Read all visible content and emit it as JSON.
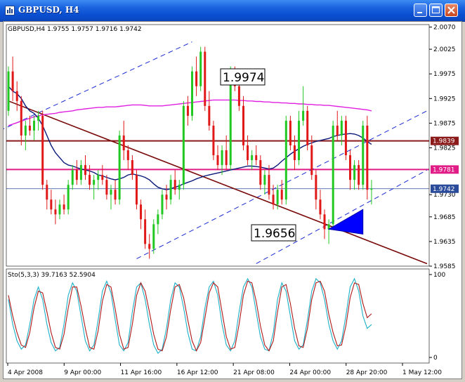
{
  "window": {
    "title": "GBPUSD, H4",
    "title_color": "#ffffff",
    "titlebar_color": "#0a4fd1",
    "close_color": "#c9461f"
  },
  "chart_data": [
    {
      "type": "candlestick",
      "title": "GBPUSD,H4 1.9755 1.9757 1.9716 1.9742",
      "symbol": "GBPUSD",
      "timeframe": "H4",
      "ylim": [
        1.9585,
        2.0075
      ],
      "y_ticks": [
        "2.0070",
        "2.0025",
        "1.9975",
        "1.9925",
        "1.9875",
        "1.9825",
        "1.9730",
        "1.9685",
        "1.9635",
        "1.9585"
      ],
      "x_ticks": [
        "4 Apr 2008",
        "9 Apr 00:00",
        "11 Apr 16:00",
        "16 Apr 12:00",
        "21 Apr 08:00",
        "24 Apr 00:00",
        "28 Apr 20:00",
        "1 May 12:00"
      ],
      "price_labels": [
        {
          "text": "1.9839",
          "value": 1.9839,
          "color": "#8b1a1a"
        },
        {
          "text": "1.9781",
          "value": 1.9781,
          "color": "#e01c86"
        },
        {
          "text": "1.9742",
          "value": 1.9742,
          "color": "#2a4a9a"
        }
      ],
      "annotations": [
        {
          "text": "1.9974",
          "value": 1.9974
        },
        {
          "text": "1.9656",
          "value": 1.9656
        }
      ],
      "colors": {
        "bull": "#22c822",
        "bear": "#e01818",
        "ma_fast": "#0a1a7a",
        "ma_slow": "#e020e0",
        "trend": "#7a0a0a",
        "channel": "#1a2ad0"
      },
      "candles": [
        [
          1.99,
          1.999,
          1.989,
          1.998
        ],
        [
          1.998,
          2.001,
          1.992,
          1.994
        ],
        [
          1.994,
          1.996,
          1.99,
          1.992
        ],
        [
          1.992,
          1.993,
          1.983,
          1.985
        ],
        [
          1.985,
          1.988,
          1.982,
          1.987
        ],
        [
          1.987,
          1.989,
          1.985,
          1.986
        ],
        [
          1.986,
          1.989,
          1.984,
          1.988
        ],
        [
          1.988,
          1.99,
          1.986,
          1.989
        ],
        [
          1.989,
          1.99,
          1.974,
          1.975
        ],
        [
          1.975,
          1.976,
          1.97,
          1.972
        ],
        [
          1.972,
          1.974,
          1.969,
          1.97
        ],
        [
          1.97,
          1.972,
          1.967,
          1.969
        ],
        [
          1.969,
          1.972,
          1.968,
          1.971
        ],
        [
          1.971,
          1.973,
          1.969,
          1.97
        ],
        [
          1.97,
          1.976,
          1.969,
          1.975
        ],
        [
          1.975,
          1.979,
          1.974,
          1.978
        ],
        [
          1.978,
          1.98,
          1.975,
          1.976
        ],
        [
          1.976,
          1.98,
          1.975,
          1.979
        ],
        [
          1.979,
          1.981,
          1.976,
          1.977
        ],
        [
          1.977,
          1.979,
          1.974,
          1.975
        ],
        [
          1.975,
          1.977,
          1.972,
          1.976
        ],
        [
          1.976,
          1.978,
          1.974,
          1.977
        ],
        [
          1.977,
          1.979,
          1.975,
          1.976
        ],
        [
          1.976,
          1.977,
          1.972,
          1.973
        ],
        [
          1.973,
          1.975,
          1.97,
          1.974
        ],
        [
          1.974,
          1.976,
          1.971,
          1.972
        ],
        [
          1.972,
          1.986,
          1.971,
          1.985
        ],
        [
          1.985,
          1.988,
          1.98,
          1.982
        ],
        [
          1.982,
          1.983,
          1.978,
          1.98
        ],
        [
          1.98,
          1.981,
          1.976,
          1.977
        ],
        [
          1.977,
          1.978,
          1.97,
          1.971
        ],
        [
          1.971,
          1.972,
          1.966,
          1.968
        ],
        [
          1.968,
          1.97,
          1.962,
          1.963
        ],
        [
          1.963,
          1.965,
          1.96,
          1.962
        ],
        [
          1.962,
          1.968,
          1.961,
          1.967
        ],
        [
          1.967,
          1.97,
          1.965,
          1.969
        ],
        [
          1.969,
          1.974,
          1.968,
          1.973
        ],
        [
          1.973,
          1.975,
          1.97,
          1.972
        ],
        [
          1.972,
          1.977,
          1.971,
          1.976
        ],
        [
          1.976,
          1.978,
          1.973,
          1.974
        ],
        [
          1.974,
          1.976,
          1.972,
          1.975
        ],
        [
          1.975,
          1.992,
          1.974,
          1.991
        ],
        [
          1.991,
          1.993,
          1.987,
          1.989
        ],
        [
          1.989,
          1.999,
          1.988,
          1.998
        ],
        [
          1.998,
          2.001,
          1.993,
          1.995
        ],
        [
          1.995,
          2.003,
          1.994,
          2.002
        ],
        [
          2.002,
          2.003,
          1.99,
          1.991
        ],
        [
          1.991,
          1.994,
          1.986,
          1.987
        ],
        [
          1.987,
          1.988,
          1.98,
          1.981
        ],
        [
          1.981,
          1.983,
          1.978,
          1.979
        ],
        [
          1.979,
          1.983,
          1.977,
          1.982
        ],
        [
          1.982,
          1.985,
          1.978,
          1.979
        ],
        [
          1.979,
          1.999,
          1.978,
          1.998
        ],
        [
          1.998,
          1.999,
          1.994,
          1.995
        ],
        [
          1.995,
          1.998,
          1.99,
          1.991
        ],
        [
          1.991,
          1.993,
          1.982,
          1.983
        ],
        [
          1.983,
          1.985,
          1.979,
          1.98
        ],
        [
          1.98,
          1.982,
          1.978,
          1.981
        ],
        [
          1.981,
          1.983,
          1.979,
          1.98
        ],
        [
          1.98,
          1.981,
          1.974,
          1.975
        ],
        [
          1.975,
          1.978,
          1.973,
          1.977
        ],
        [
          1.977,
          1.979,
          1.972,
          1.973
        ],
        [
          1.973,
          1.975,
          1.97,
          1.971
        ],
        [
          1.971,
          1.975,
          1.97,
          1.974
        ],
        [
          1.974,
          1.976,
          1.971,
          1.972
        ],
        [
          1.972,
          1.989,
          1.971,
          1.988
        ],
        [
          1.988,
          1.989,
          1.982,
          1.983
        ],
        [
          1.983,
          1.985,
          1.978,
          1.98
        ],
        [
          1.98,
          1.99,
          1.979,
          1.988
        ],
        [
          1.988,
          1.995,
          1.987,
          1.99
        ],
        [
          1.99,
          1.991,
          1.982,
          1.983
        ],
        [
          1.983,
          1.985,
          1.976,
          1.977
        ],
        [
          1.977,
          1.978,
          1.97,
          1.972
        ],
        [
          1.972,
          1.974,
          1.968,
          1.969
        ],
        [
          1.969,
          1.97,
          1.964,
          1.966
        ],
        [
          1.966,
          1.968,
          1.963,
          1.967
        ],
        [
          1.967,
          1.988,
          1.966,
          1.987
        ],
        [
          1.987,
          1.99,
          1.984,
          1.985
        ],
        [
          1.985,
          1.989,
          1.983,
          1.988
        ],
        [
          1.988,
          1.989,
          1.98,
          1.981
        ],
        [
          1.981,
          1.982,
          1.974,
          1.976
        ],
        [
          1.976,
          1.98,
          1.974,
          1.979
        ],
        [
          1.979,
          1.98,
          1.974,
          1.975
        ],
        [
          1.975,
          1.988,
          1.974,
          1.987
        ],
        [
          1.987,
          1.989,
          1.972,
          1.974
        ],
        [
          1.974,
          1.976,
          1.971,
          1.9742
        ]
      ],
      "sma_fast": [
        1.995,
        1.994,
        1.9935,
        1.9925,
        1.991,
        1.99,
        1.9895,
        1.9885,
        1.987,
        1.985,
        1.983,
        1.9815,
        1.9805,
        1.9795,
        1.979,
        1.9788,
        1.9785,
        1.9782,
        1.978,
        1.9778,
        1.9775,
        1.977,
        1.9768,
        1.9765,
        1.9762,
        1.976,
        1.9762,
        1.9765,
        1.977,
        1.9772,
        1.977,
        1.9768,
        1.9765,
        1.976,
        1.9752,
        1.9745,
        1.9742,
        1.974,
        1.9742,
        1.9745,
        1.9748,
        1.9752,
        1.9755,
        1.9758,
        1.9762,
        1.9765,
        1.9768,
        1.977,
        1.9772,
        1.9774,
        1.9776,
        1.9778,
        1.978,
        1.9782,
        1.9784,
        1.9786,
        1.9788,
        1.9788,
        1.9787,
        1.9786,
        1.9784,
        1.9782,
        1.9784,
        1.979,
        1.9798,
        1.9805,
        1.9812,
        1.9818,
        1.9823,
        1.9828,
        1.9832,
        1.9835,
        1.9838,
        1.984,
        1.9842,
        1.9844,
        1.9848,
        1.985,
        1.9852,
        1.9853,
        1.9854,
        1.9853,
        1.985,
        1.9845,
        1.9838,
        1.9832
      ],
      "sma_slow": [
        1.987,
        1.9873,
        1.9876,
        1.9879,
        1.9882,
        1.9885,
        1.9888,
        1.989,
        1.9892,
        1.9893,
        1.9894,
        1.9895,
        1.9897,
        1.9898,
        1.9899,
        1.99,
        1.9902,
        1.9903,
        1.9904,
        1.9905,
        1.9906,
        1.9907,
        1.9907,
        1.9908,
        1.9908,
        1.9908,
        1.9909,
        1.991,
        1.9911,
        1.9912,
        1.9912,
        1.9912,
        1.9911,
        1.991,
        1.991,
        1.991,
        1.991,
        1.9911,
        1.9912,
        1.9913,
        1.9914,
        1.9915,
        1.9916,
        1.9917,
        1.9918,
        1.9919,
        1.992,
        1.9921,
        1.9922,
        1.9922,
        1.9922,
        1.9922,
        1.9922,
        1.9922,
        1.9921,
        1.9921,
        1.992,
        1.992,
        1.9919,
        1.9919,
        1.9918,
        1.9918,
        1.9917,
        1.9917,
        1.9916,
        1.9916,
        1.9915,
        1.9915,
        1.9914,
        1.9914,
        1.9913,
        1.9913,
        1.9912,
        1.9912,
        1.9911,
        1.9911,
        1.991,
        1.9909,
        1.9908,
        1.9907,
        1.9906,
        1.9905,
        1.9904,
        1.9903,
        1.9902,
        1.99
      ],
      "h_levels": [
        {
          "value": 1.9839,
          "color": "#8b1a1a"
        },
        {
          "value": 1.9781,
          "color": "#e01c86"
        },
        {
          "value": 1.9742,
          "color": "#2a4a9a"
        }
      ],
      "trendline": {
        "from": [
          0,
          1.992
        ],
        "to": [
          98,
          1.959
        ],
        "color": "#7a0a0a"
      },
      "channel": [
        {
          "from": [
            -2,
            1.986
          ],
          "to": [
            43,
            2.004
          ]
        },
        {
          "from": [
            30,
            1.96
          ],
          "to": [
            98,
            1.99
          ]
        },
        {
          "from": [
            58,
            1.959
          ],
          "to": [
            98,
            1.978
          ]
        }
      ],
      "triangle": [
        [
          75,
          1.966
        ],
        [
          83,
          1.97
        ],
        [
          83,
          1.965
        ]
      ]
    },
    {
      "type": "line",
      "title": "Sto(5,3,3) 39.7163 52.5904",
      "ylim": [
        0,
        100
      ],
      "y_ticks": [
        "100",
        "0"
      ],
      "series": [
        {
          "values": [
            70,
            40,
            20,
            10,
            15,
            40,
            70,
            85,
            70,
            40,
            18,
            8,
            12,
            40,
            75,
            90,
            80,
            50,
            20,
            8,
            15,
            45,
            80,
            92,
            78,
            45,
            15,
            8,
            18,
            55,
            85,
            90,
            70,
            40,
            15,
            5,
            10,
            35,
            70,
            90,
            85,
            60,
            30,
            10,
            8,
            25,
            60,
            85,
            92,
            75,
            40,
            15,
            8,
            20,
            55,
            85,
            95,
            85,
            55,
            25,
            10,
            8,
            30,
            70,
            90,
            80,
            50,
            20,
            10,
            15,
            45,
            80,
            95,
            90,
            70,
            40,
            20,
            10,
            20,
            50,
            85,
            95,
            80,
            50,
            35,
            39.7
          ],
          "color": "#1bb0c8"
        },
        {
          "values": [
            75,
            50,
            30,
            15,
            12,
            30,
            60,
            80,
            78,
            55,
            30,
            12,
            10,
            28,
            60,
            85,
            85,
            62,
            35,
            12,
            10,
            32,
            68,
            88,
            85,
            58,
            28,
            10,
            12,
            40,
            75,
            90,
            80,
            55,
            28,
            10,
            8,
            25,
            58,
            85,
            88,
            72,
            45,
            20,
            8,
            18,
            48,
            78,
            90,
            85,
            55,
            25,
            10,
            12,
            40,
            75,
            92,
            90,
            68,
            38,
            15,
            8,
            20,
            55,
            85,
            88,
            65,
            35,
            14,
            12,
            35,
            70,
            90,
            92,
            80,
            52,
            30,
            14,
            15,
            38,
            72,
            90,
            88,
            65,
            48,
            52.6
          ],
          "color": "#b01818"
        }
      ]
    }
  ]
}
